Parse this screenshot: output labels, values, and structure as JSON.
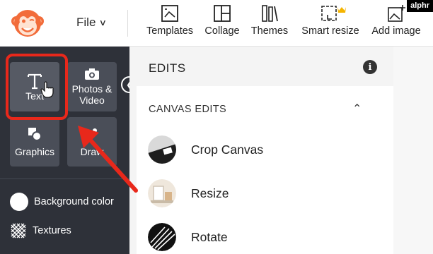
{
  "topbar": {
    "file_label": "File",
    "tools": [
      {
        "label": "Templates",
        "icon": "templates-icon"
      },
      {
        "label": "Collage",
        "icon": "collage-icon"
      },
      {
        "label": "Themes",
        "icon": "themes-icon"
      },
      {
        "label": "Smart resize",
        "icon": "smart-resize-icon"
      },
      {
        "label": "Add image",
        "icon": "add-image-icon"
      }
    ],
    "badge": "alphr"
  },
  "sidebar": {
    "tiles": [
      {
        "label": "Text",
        "icon": "text-icon"
      },
      {
        "label": "Photos & Video",
        "icon": "camera-icon"
      },
      {
        "label": "Graphics",
        "icon": "shapes-icon"
      },
      {
        "label": "Draw",
        "icon": "pen-icon"
      }
    ],
    "rows": [
      {
        "label": "Background color",
        "icon": "color-dot-icon"
      },
      {
        "label": "Textures",
        "icon": "texture-icon"
      }
    ]
  },
  "edits": {
    "title": "EDITS",
    "section_title": "CANVAS EDITS",
    "items": [
      {
        "label": "Crop Canvas",
        "icon": "crop-thumb-icon"
      },
      {
        "label": "Resize",
        "icon": "resize-thumb-icon"
      },
      {
        "label": "Rotate",
        "icon": "rotate-thumb-icon"
      }
    ]
  },
  "colors": {
    "brand": "#f26c3a",
    "panel_dark": "#2e3139",
    "annotation_red": "#e8281b"
  }
}
